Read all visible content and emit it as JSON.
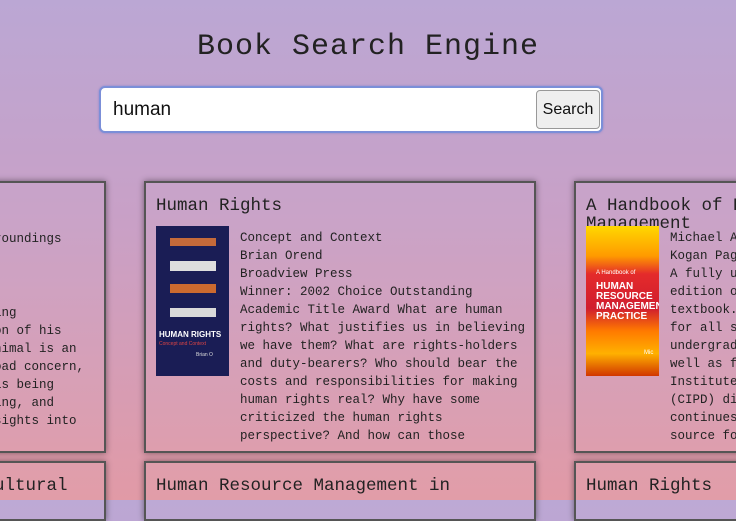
{
  "header": {
    "title": "Book Search Engine"
  },
  "search": {
    "value": "human",
    "button_label": "Search"
  },
  "cards": [
    {
      "title": "",
      "lines": [
        "roundings",
        "",
        "",
        "ing",
        "on of his",
        "nimal is an",
        "oad concern,",
        "is being",
        "ing, and",
        "sights into"
      ]
    },
    {
      "title": "Human Rights",
      "subtitle": "Concept and Context",
      "author": "Brian Orend",
      "publisher": "Broadview Press",
      "description": [
        "Winner: 2002 Choice Outstanding",
        "Academic Title Award What are human",
        "rights? What justifies us in believing",
        "we have them? What are rights-holders",
        "and duty-bearers? Who should bear the",
        "costs and responsibilities for making",
        "human rights real? Why have some",
        "criticized the human rights",
        "perspective? And how can those"
      ],
      "cover_title": "HUMAN RIGHTS",
      "cover_subtitle": "Concept and Context",
      "cover_author": "Brian O"
    },
    {
      "title": "A Handbook of Human Resource",
      "title_line2": "Management",
      "lines": [
        "Michael A",
        "Kogan Pag",
        "A fully up",
        "edition of",
        "textbook.",
        "for all st",
        "undergradu",
        "well as fo",
        "Institute",
        "(CIPD) dip",
        "continues",
        "source fo"
      ],
      "cover_small": "A Handbook of",
      "cover_title": "HUMAN RESOURCE MANAGEMENT PRACTICE",
      "cover_author": "Mic"
    }
  ],
  "bottom_cards": [
    {
      "title": "ultural"
    },
    {
      "title": "Human Resource Management in"
    },
    {
      "title": "Human Rights"
    }
  ]
}
